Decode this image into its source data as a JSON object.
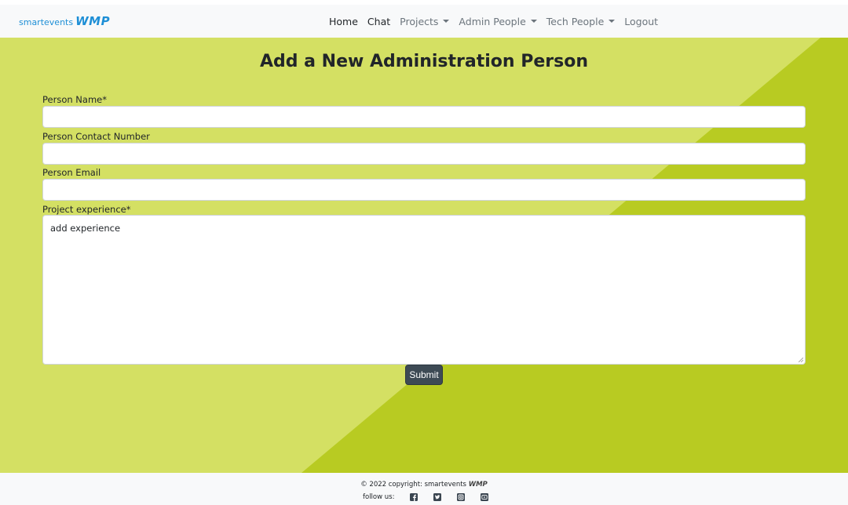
{
  "brand": {
    "small": "smartevents",
    "big": "WMP"
  },
  "nav": {
    "home": "Home",
    "chat": "Chat",
    "projects": "Projects",
    "admin_people": "Admin People",
    "tech_people": "Tech People",
    "logout": "Logout"
  },
  "form": {
    "title": "Add a New Administration Person",
    "name_label": "Person Name*",
    "contact_label": "Person Contact Number",
    "email_label": "Person Email",
    "experience_label": "Project experience*",
    "experience_value": "add experience",
    "submit_label": "Submit"
  },
  "footer": {
    "copyright": "© 2022 copyright: smartevents",
    "brand": "WMP",
    "follow": "follow us:"
  },
  "colors": {
    "background_light": "#d4e063",
    "background_dark": "#b8cb22",
    "brand": "#1e8fd6",
    "submit": "#3d4a54"
  },
  "icons": [
    "facebook-icon",
    "twitter-icon",
    "instagram-icon",
    "youtube-icon"
  ]
}
